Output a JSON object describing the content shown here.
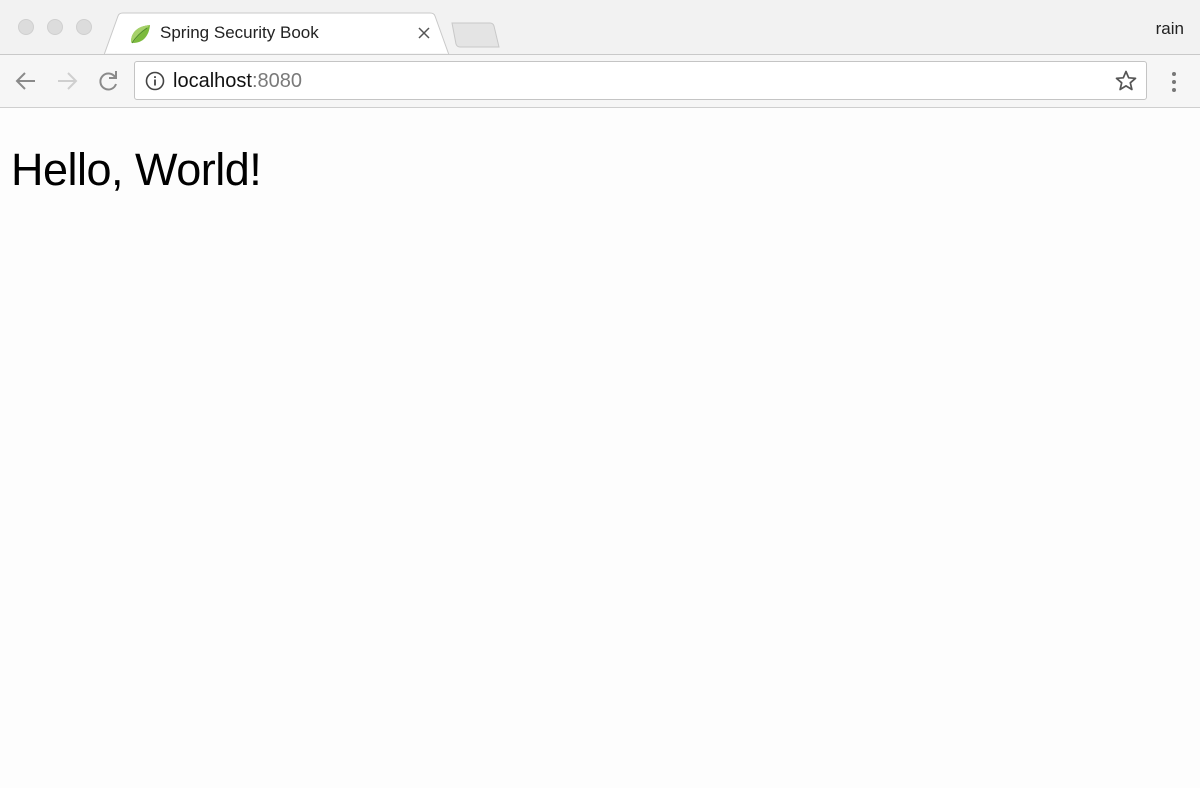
{
  "browser": {
    "tab": {
      "title": "Spring Security Book",
      "favicon": "spring-leaf-icon"
    },
    "profile_name": "rain",
    "address_bar": {
      "host": "localhost",
      "port": ":8080"
    },
    "icons": {
      "back": "arrow-left-icon",
      "forward": "arrow-right-icon",
      "reload": "reload-icon",
      "info": "info-icon",
      "bookmark": "star-icon",
      "menu": "kebab-menu-icon",
      "close_tab": "close-icon"
    },
    "colors": {
      "favicon_green": "#6db33f",
      "titlebar": "#f2f2f2",
      "toolbar": "#f6f6f6"
    }
  },
  "page": {
    "heading": "Hello, World!"
  }
}
